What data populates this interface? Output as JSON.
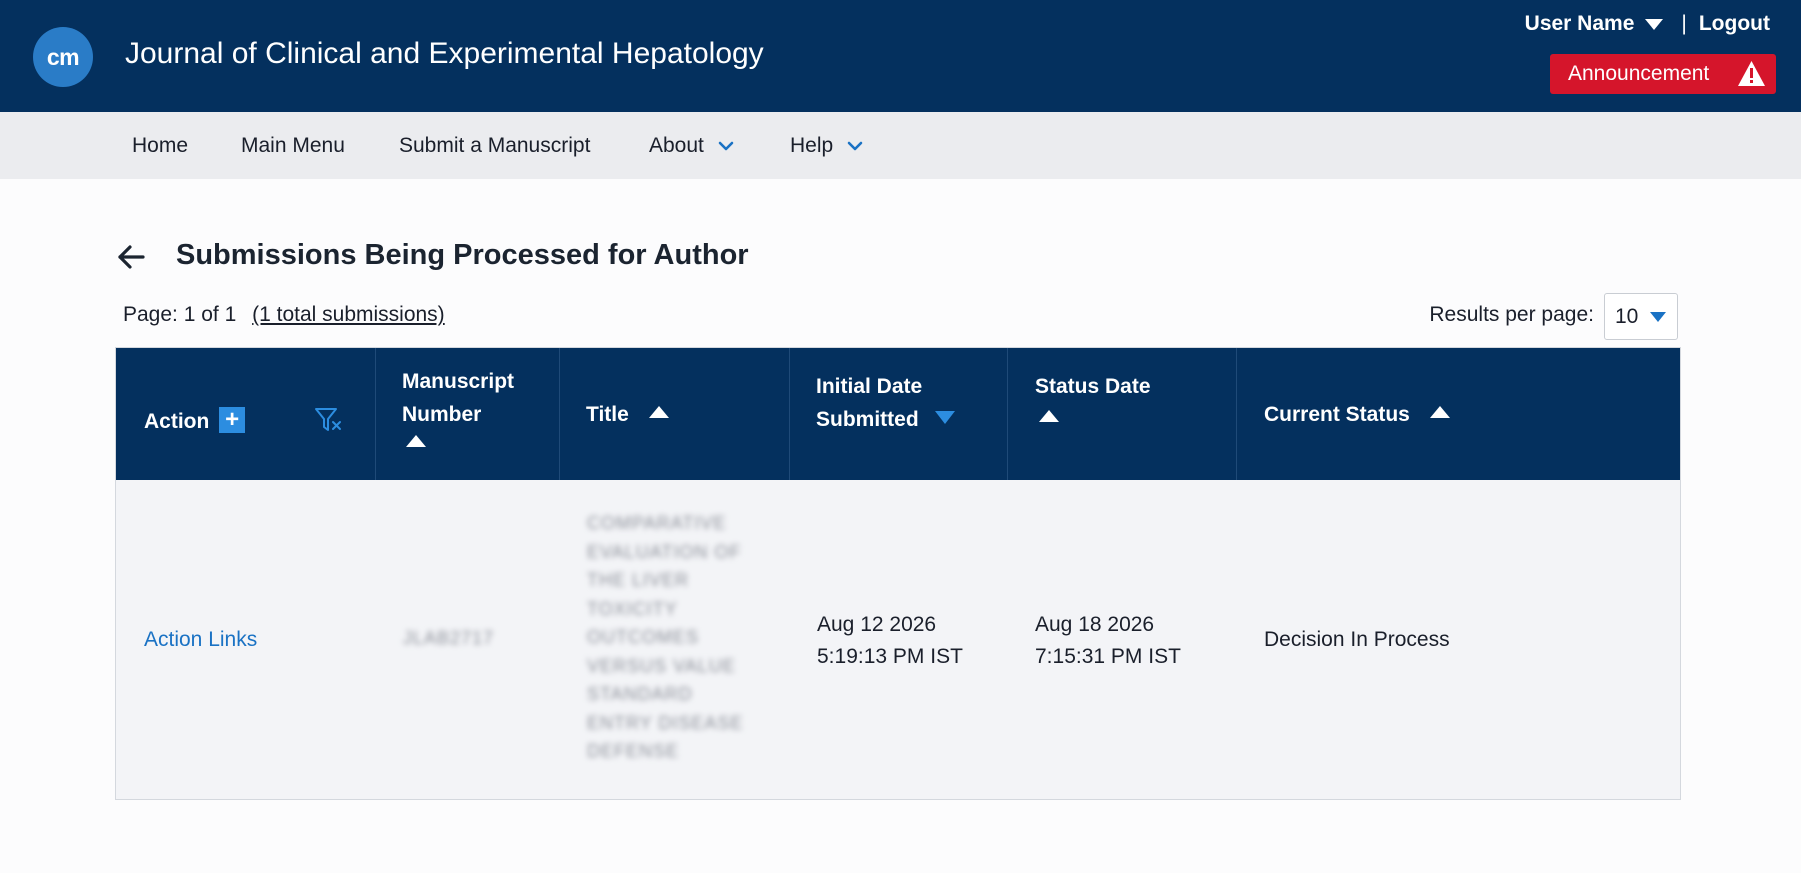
{
  "header": {
    "logo_text": "cm",
    "journal_title": "Journal of Clinical and Experimental Hepatology",
    "user_name": "User Name",
    "separator": "|",
    "logout": "Logout",
    "announcement": "Announcement"
  },
  "nav": {
    "items": [
      {
        "label": "Home"
      },
      {
        "label": "Main Menu"
      },
      {
        "label": "Submit a Manuscript"
      },
      {
        "label": "About"
      },
      {
        "label": "Help"
      }
    ]
  },
  "page": {
    "title": "Submissions Being Processed for Author",
    "page_info": "Page: 1 of 1",
    "total_link": "(1 total submissions)",
    "results_label": "Results per page:",
    "results_value": "10"
  },
  "table": {
    "columns": {
      "action": "Action",
      "add_symbol": "+",
      "manuscript_number_1": "Manuscript",
      "manuscript_number_2": "Number",
      "title": "Title",
      "initial_date_1": "Initial Date",
      "initial_date_2": "Submitted",
      "status_date": "Status Date",
      "current_status": "Current Status"
    },
    "rows": [
      {
        "action": "Action Links",
        "manuscript_number": "JLAB2717",
        "title_lines": [
          "Comparative",
          "Evaluation of",
          "the Liver",
          "Toxicity",
          "Outcomes",
          "Versus Value",
          "Standard",
          "Entry Disease",
          "Defense"
        ],
        "initial_date_line1": "Aug 12 2026",
        "initial_date_line2": "5:19:13 PM IST",
        "status_date_line1": "Aug 18 2026",
        "status_date_line2": "7:15:31 PM IST",
        "current_status": "Decision In Process"
      }
    ]
  },
  "colors": {
    "header_bg": "#04305e",
    "nav_bg": "#ebecef",
    "announcement_bg": "#d5152b",
    "accent_blue": "#2c8de0",
    "link_blue": "#1a72c4"
  },
  "icons": {
    "warning": "warning-triangle-icon",
    "back": "back-arrow-icon",
    "filter_clear": "filter-clear-icon",
    "chevron": "chevron-down-icon"
  }
}
